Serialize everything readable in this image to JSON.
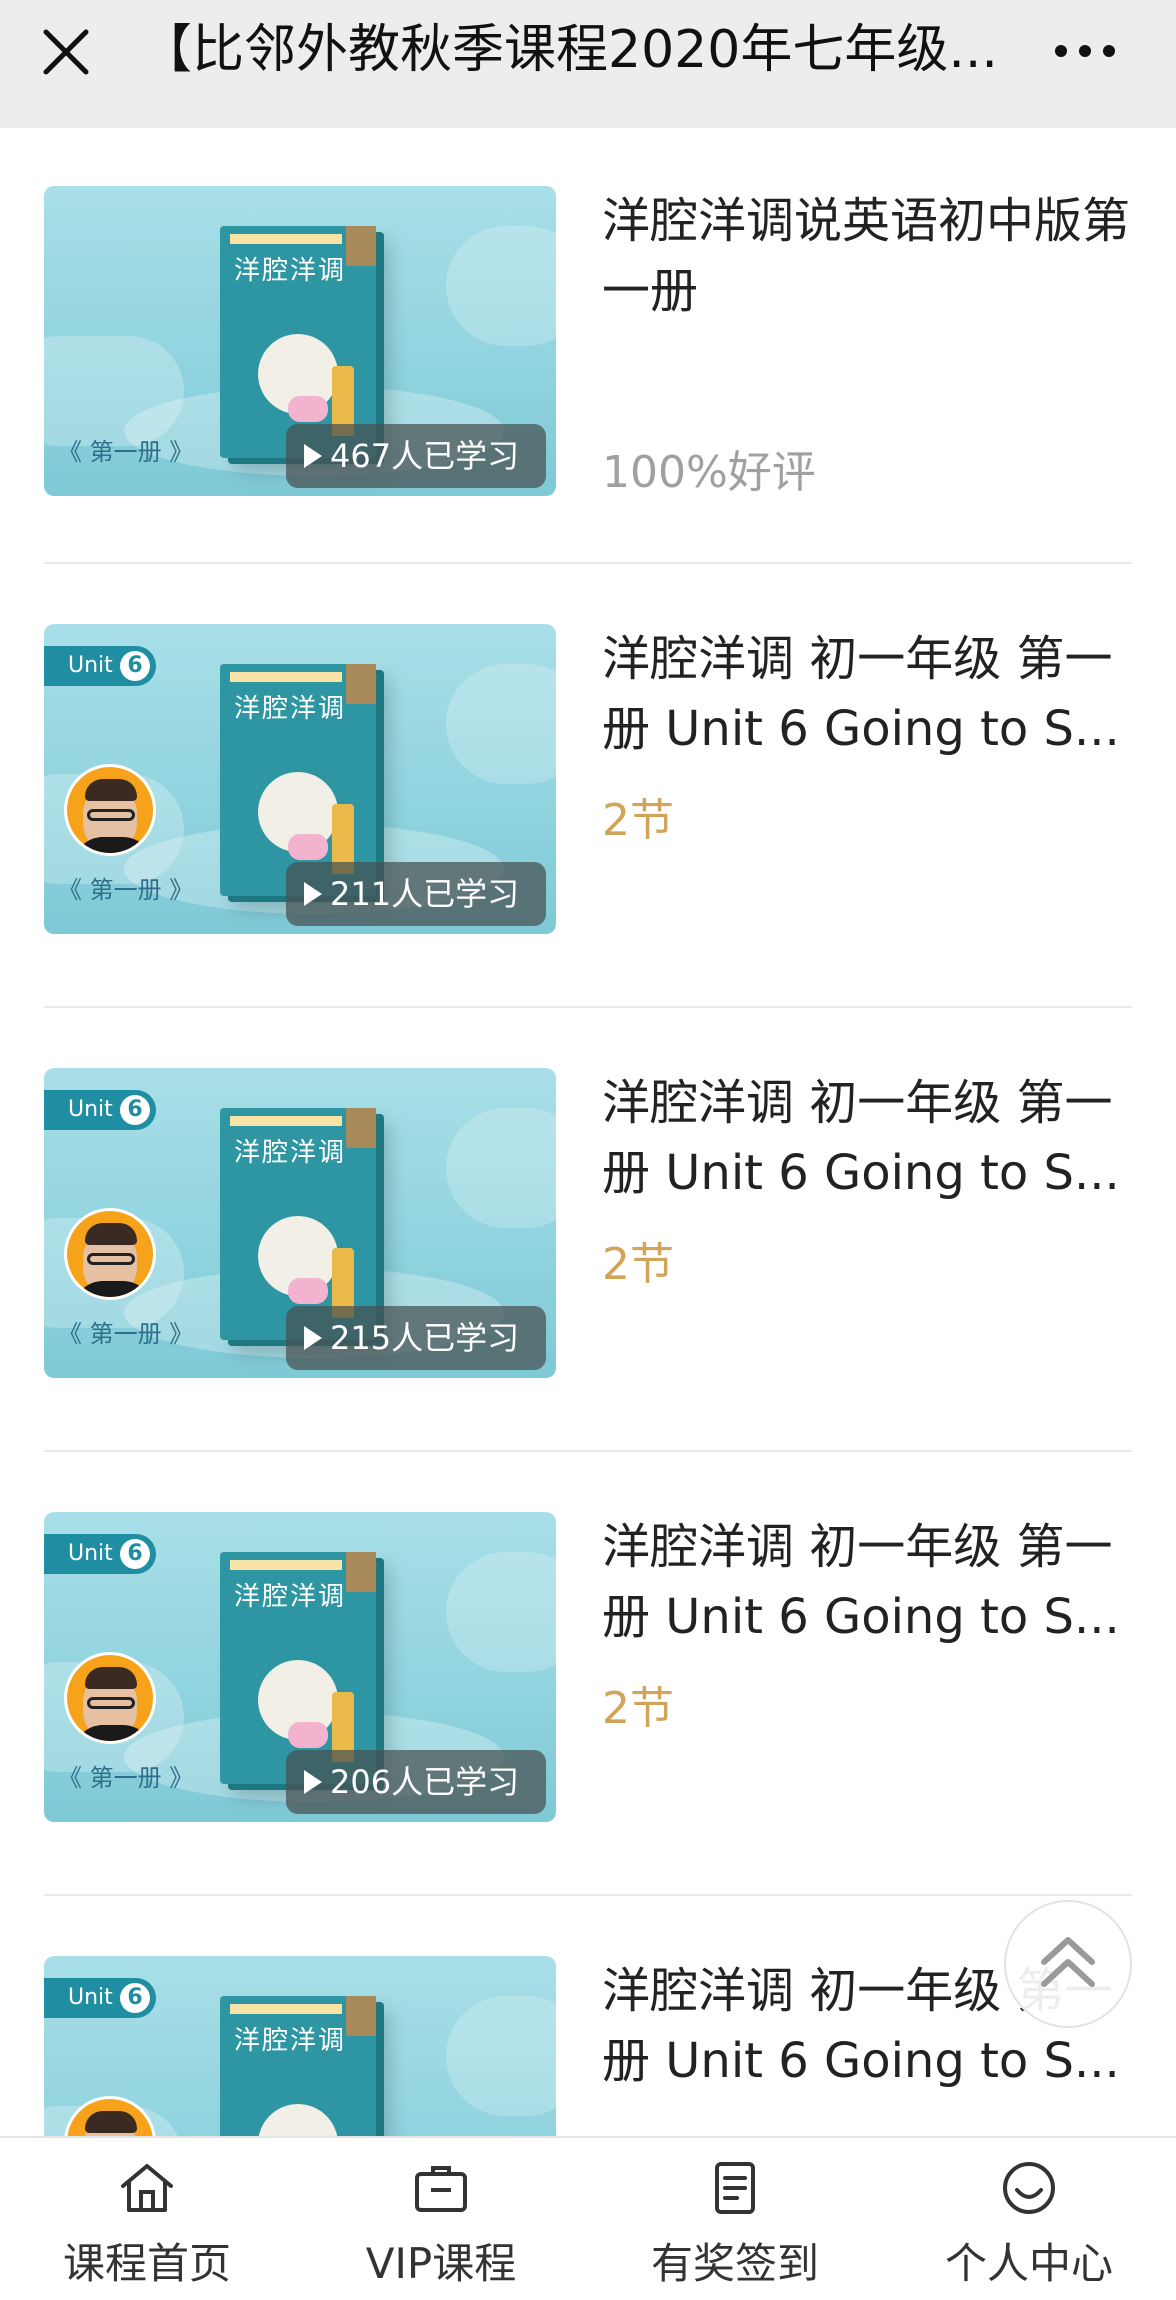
{
  "header": {
    "title": "【比邻外教秋季课程2020年七年级...",
    "close_icon": "close-icon",
    "more_icon": "more-dots-icon"
  },
  "courses": [
    {
      "title": "洋腔洋调说英语初中版第一册",
      "learners": "467人已学习",
      "meta": "100%好评",
      "volume": "《 第一册 》",
      "book_title": "洋腔洋调",
      "has_unit": false,
      "meta_color": "#a0a0a0"
    },
    {
      "title": "洋腔洋调 初一年级 第一册 Unit 6 Going to S...",
      "learners": "211人已学习",
      "meta": "2节",
      "volume": "《 第一册 》",
      "book_title": "洋腔洋调",
      "unit_label": "Unit",
      "unit_number": "6",
      "has_unit": true,
      "meta_color": "#d1a45a"
    },
    {
      "title": "洋腔洋调 初一年级 第一册 Unit 6 Going to S...",
      "learners": "215人已学习",
      "meta": "2节",
      "volume": "《 第一册 》",
      "book_title": "洋腔洋调",
      "unit_label": "Unit",
      "unit_number": "6",
      "has_unit": true,
      "meta_color": "#d1a45a"
    },
    {
      "title": "洋腔洋调 初一年级 第一册 Unit 6 Going to S...",
      "learners": "206人已学习",
      "meta": "2节",
      "volume": "《 第一册 》",
      "book_title": "洋腔洋调",
      "unit_label": "Unit",
      "unit_number": "6",
      "has_unit": true,
      "meta_color": "#d1a45a"
    },
    {
      "title": "洋腔洋调 初一年级 第一册 Unit 6 Going to S...",
      "learners": "",
      "meta": "",
      "volume": "",
      "book_title": "洋腔洋调",
      "unit_label": "Unit",
      "unit_number": "6",
      "has_unit": true,
      "meta_color": "#d1a45a"
    }
  ],
  "back_to_top_icon": "double-chevron-up-icon",
  "tabbar": {
    "items": [
      {
        "label": "课程首页",
        "icon": "home-icon"
      },
      {
        "label": "VIP课程",
        "icon": "briefcase-icon"
      },
      {
        "label": "有奖签到",
        "icon": "document-icon"
      },
      {
        "label": "个人中心",
        "icon": "smiley-icon"
      }
    ]
  },
  "colors": {
    "topbar_bg": "#ededed",
    "accent_gold": "#d1a45a",
    "muted_gray": "#a0a0a0",
    "thumb_teal": "#2e96a3"
  }
}
